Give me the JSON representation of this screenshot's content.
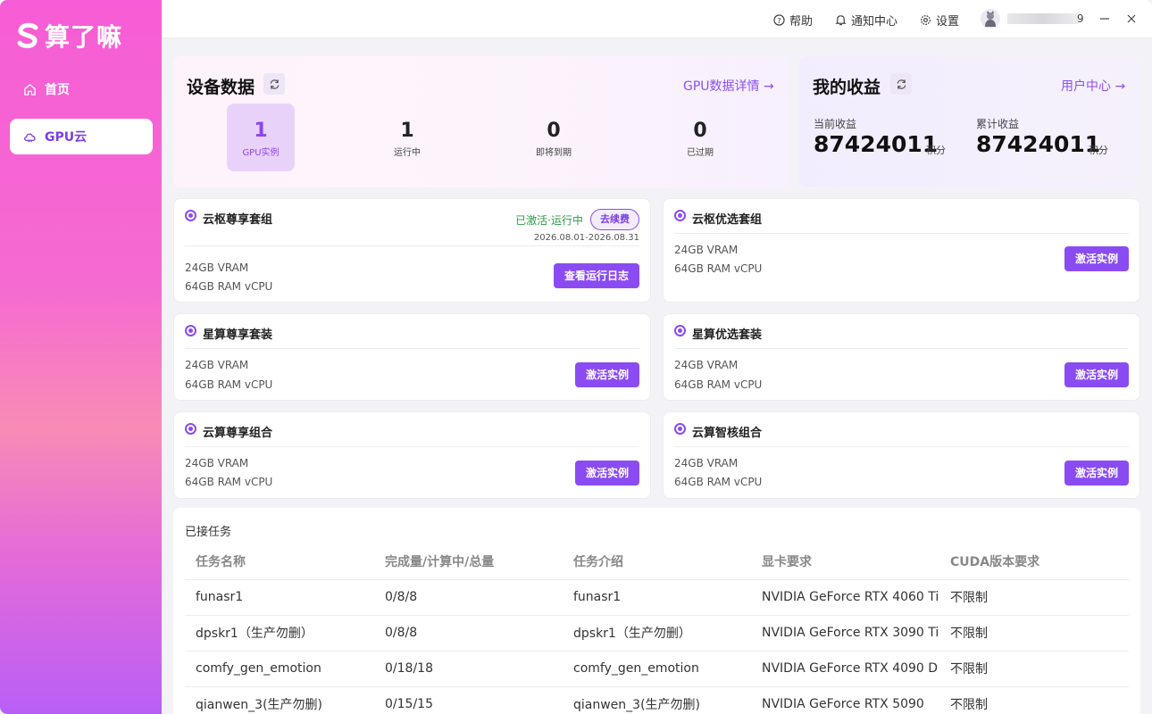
{
  "app": {
    "name": "算了嘛",
    "brand_color": "#8a4cf2"
  },
  "sidebar": {
    "items": [
      {
        "label": "首页",
        "icon": "home-icon",
        "active": false
      },
      {
        "label": "GPU云",
        "icon": "cloud-icon",
        "active": true
      }
    ]
  },
  "topbar": {
    "help": "帮助",
    "notifications": "通知中心",
    "settings": "设置",
    "username_tail": "9"
  },
  "device_data": {
    "title": "设备数据",
    "detail_link": "GPU数据详情 →",
    "stats": [
      {
        "value": "1",
        "label": "GPU实例"
      },
      {
        "value": "1",
        "label": "运行中"
      },
      {
        "value": "0",
        "label": "即将到期"
      },
      {
        "value": "0",
        "label": "已过期"
      }
    ]
  },
  "earnings": {
    "title": "我的收益",
    "user_center_link": "用户中心 →",
    "current_label": "当前收益",
    "current_value": "87424011",
    "total_label": "累计收益",
    "total_value": "87424011",
    "unit": "积分"
  },
  "packages": [
    {
      "name": "云枢尊享套组",
      "spec1": "24GB VRAM",
      "spec2": "64GB RAM vCPU",
      "status": "已激活·运行中",
      "renew": "去续费",
      "date_range": "2026.08.01-2026.08.31",
      "action": "查看运行日志"
    },
    {
      "name": "云枢优选套组",
      "spec1": "24GB VRAM",
      "spec2": "64GB RAM vCPU",
      "action": "激活实例"
    },
    {
      "name": "星算尊享套装",
      "spec1": "24GB VRAM",
      "spec2": "64GB RAM vCPU",
      "action": "激活实例"
    },
    {
      "name": "星算优选套装",
      "spec1": "24GB VRAM",
      "spec2": "64GB RAM vCPU",
      "action": "激活实例"
    },
    {
      "name": "云算尊享组合",
      "spec1": "24GB VRAM",
      "spec2": "64GB RAM vCPU",
      "action": "激活实例"
    },
    {
      "name": "云算智核组合",
      "spec1": "24GB VRAM",
      "spec2": "64GB RAM vCPU",
      "action": "激活实例"
    }
  ],
  "tasks": {
    "title": "已接任务",
    "columns": [
      "任务名称",
      "完成量/计算中/总量",
      "任务介绍",
      "显卡要求",
      "CUDA版本要求"
    ],
    "rows": [
      [
        "funasr1",
        "0/8/8",
        "funasr1",
        "NVIDIA GeForce RTX 4060 Ti",
        "不限制"
      ],
      [
        "dpskr1（生产勿删）",
        "0/8/8",
        "dpskr1（生产勿删）",
        "NVIDIA GeForce RTX 3090 Ti",
        "不限制"
      ],
      [
        "comfy_gen_emotion",
        "0/18/18",
        "comfy_gen_emotion",
        "NVIDIA GeForce RTX 4090 D",
        "不限制"
      ],
      [
        "qianwen_3(生产勿删)",
        "0/15/15",
        "qianwen_3(生产勿删)",
        "NVIDIA GeForce RTX 5090",
        "不限制"
      ]
    ]
  }
}
